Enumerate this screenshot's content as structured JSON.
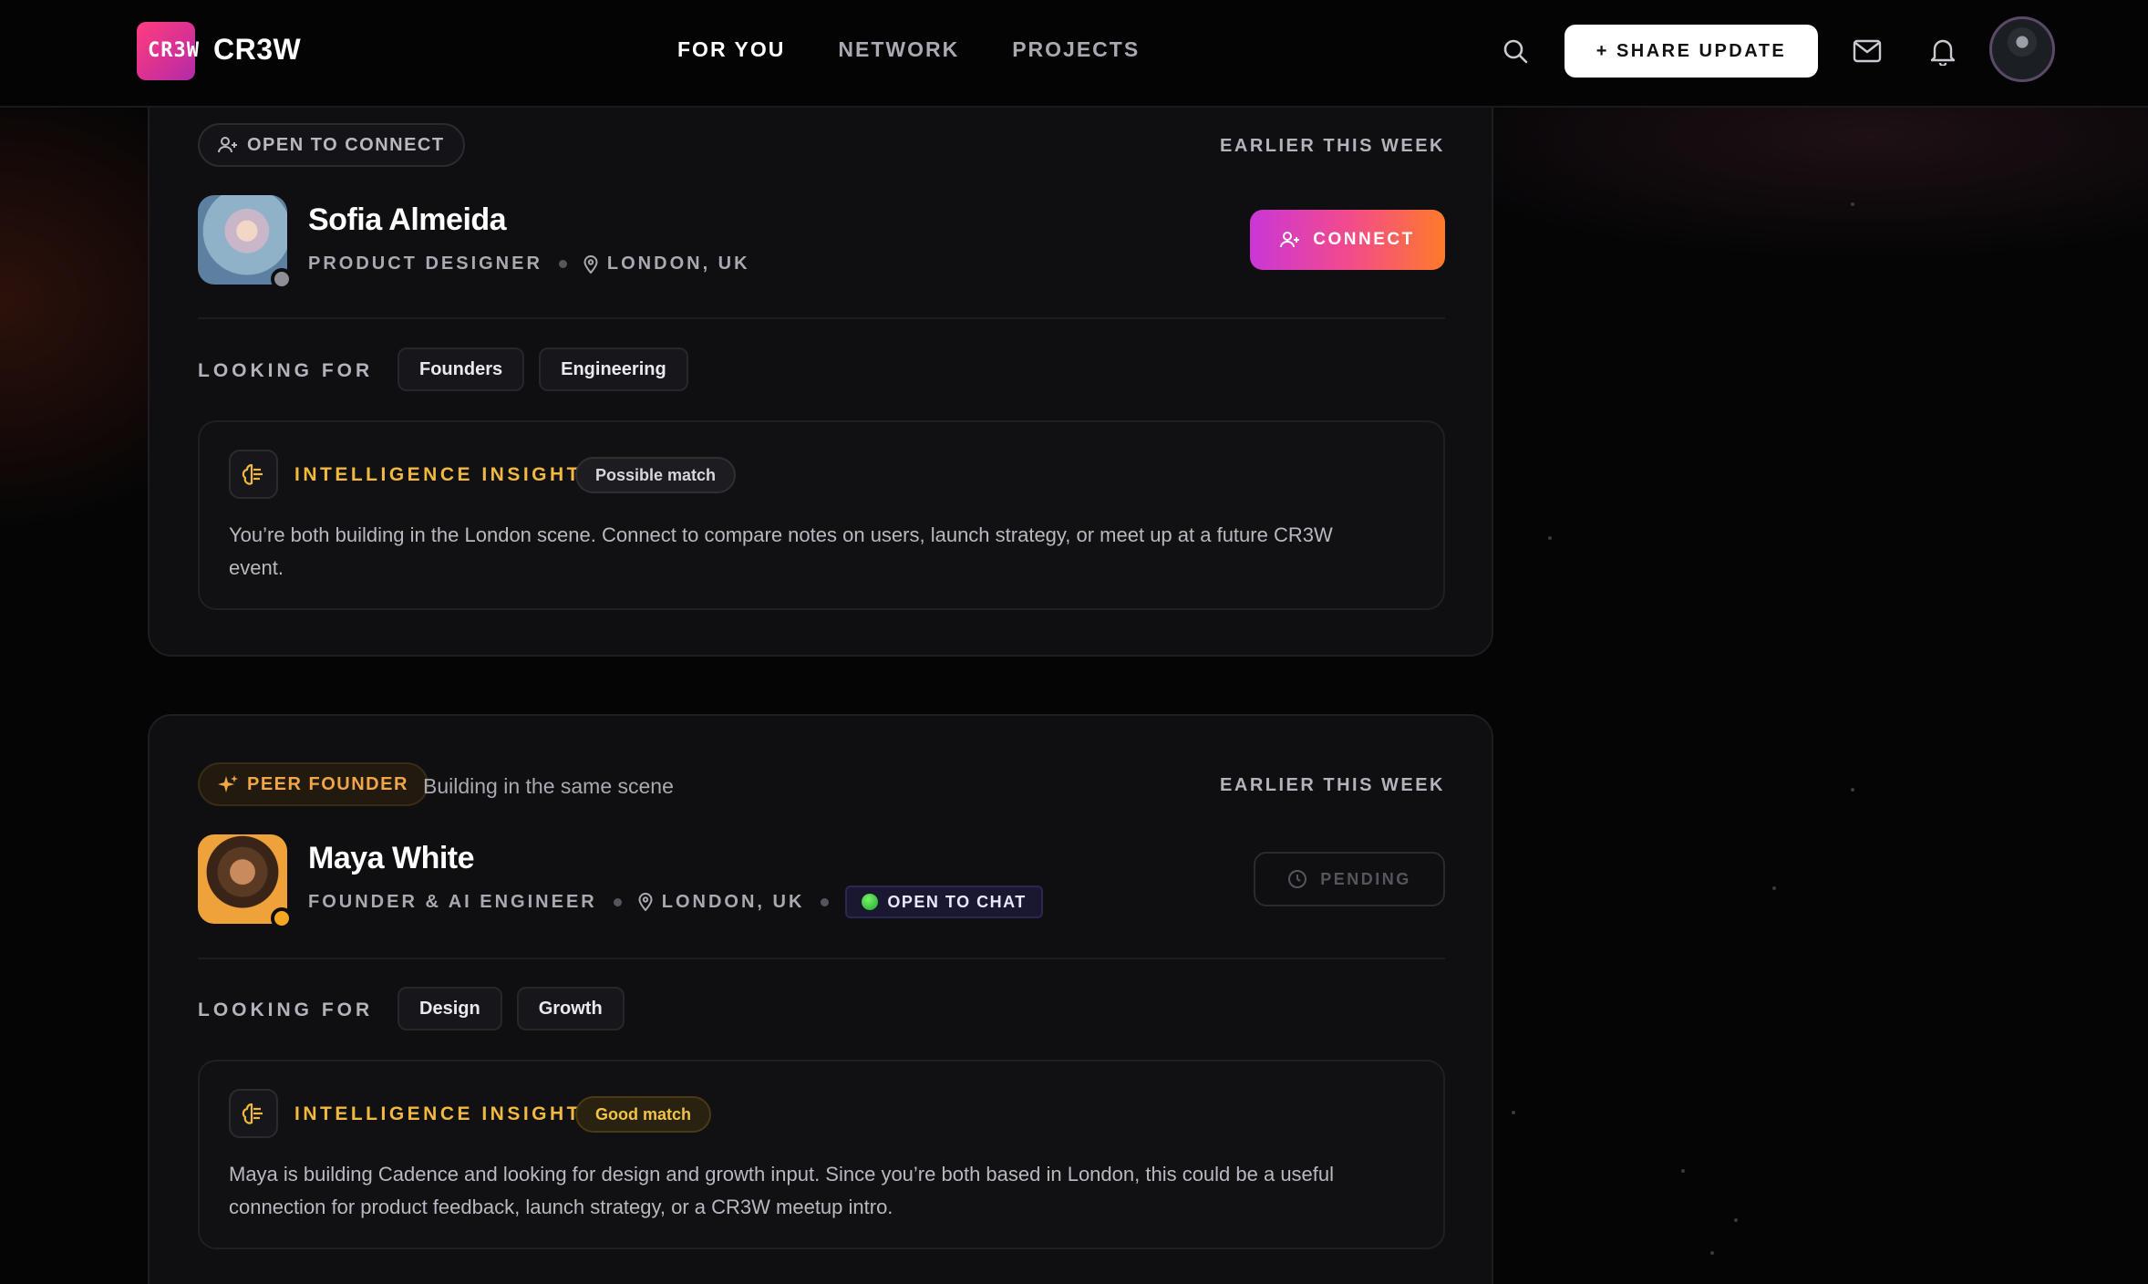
{
  "app": {
    "brand": "CR3W",
    "logo_glyph": "CR3W",
    "accent_gradient": [
      "#c937d6",
      "#f24a8e",
      "#ff7a2a"
    ]
  },
  "nav": {
    "items": [
      {
        "label": "FOR YOU",
        "active": true
      },
      {
        "label": "NETWORK",
        "active": false
      },
      {
        "label": "PROJECTS",
        "active": false
      }
    ]
  },
  "header": {
    "share_label": "+ SHARE UPDATE",
    "icons": [
      "search-icon",
      "mail-icon",
      "bell-icon"
    ]
  },
  "feed": [
    {
      "badge": "OPEN TO CONNECT",
      "badge_icon": "user-plus-icon",
      "note": "",
      "when": "EARLIER THIS WEEK",
      "name": "Sofia Almeida",
      "role": "PRODUCT DESIGNER",
      "location": "LONDON, UK",
      "presence_color": "#8e8e96",
      "action": "CONNECT",
      "looking_for_label": "LOOKING FOR",
      "looking_for": [
        "Founders",
        "Engineering"
      ],
      "insight_title": "INTELLIGENCE INSIGHT",
      "match": "Possible match",
      "insight": "You’re both building in the London scene. Connect to compare notes on users, launch strategy, or meet up at a future CR3W event."
    },
    {
      "badge": "PEER FOUNDER",
      "badge_icon": "sparkle-icon",
      "note": "Building in the same scene",
      "when": "EARLIER THIS WEEK",
      "name": "Maya White",
      "role": "FOUNDER & AI ENGINEER",
      "location": "LONDON, UK",
      "status": "OPEN TO CHAT",
      "presence_color": "#f5a623",
      "action": "PENDING",
      "looking_for_label": "LOOKING FOR",
      "looking_for": [
        "Design",
        "Growth"
      ],
      "insight_title": "INTELLIGENCE INSIGHT",
      "match": "Good match",
      "insight": "Maya is building Cadence and looking for design and growth input. Since you’re both based in London, this could be a useful connection for product feedback, launch strategy, or a CR3W meetup intro."
    }
  ]
}
